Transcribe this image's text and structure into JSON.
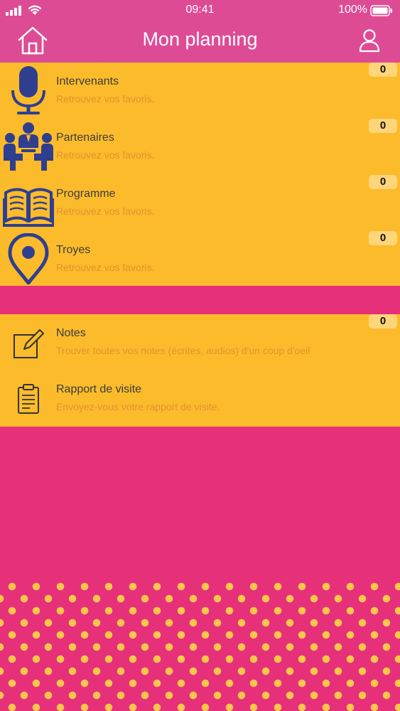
{
  "status_bar": {
    "time": "09:41",
    "battery": "100%"
  },
  "header": {
    "title": "Mon planning",
    "home_icon": "home-icon",
    "profile_icon": "user-icon"
  },
  "favorites": [
    {
      "label": "Intervenants",
      "subtitle": "Retrouvez vos favoris.",
      "count": "0",
      "icon": "microphone-icon"
    },
    {
      "label": "Partenaires",
      "subtitle": "Retrouvez vos favoris.",
      "count": "0",
      "icon": "partners-icon"
    },
    {
      "label": "Programme",
      "subtitle": "Retrouvez vos favoris.",
      "count": "0",
      "icon": "book-icon"
    },
    {
      "label": "Troyes",
      "subtitle": "Retrouvez vos favoris.",
      "count": "0",
      "icon": "location-pin-icon"
    }
  ],
  "tools": [
    {
      "label": "Notes",
      "subtitle": "Trouver toutes vos notes (écrites, audios) d'un coup d'oeil",
      "count": "0",
      "icon": "edit-note-icon"
    },
    {
      "label": "Rapport de visite",
      "subtitle": "Envoyez-vous votre rapport de visite.",
      "icon": "clipboard-icon"
    }
  ],
  "colors": {
    "header_bg": "#de4b95",
    "page_bg": "#e6307a",
    "panel_bg": "#fbbb2b",
    "icon_color": "#2f3f8f",
    "subtitle_color": "#e5922e",
    "badge_bg": "#ffd57a"
  }
}
